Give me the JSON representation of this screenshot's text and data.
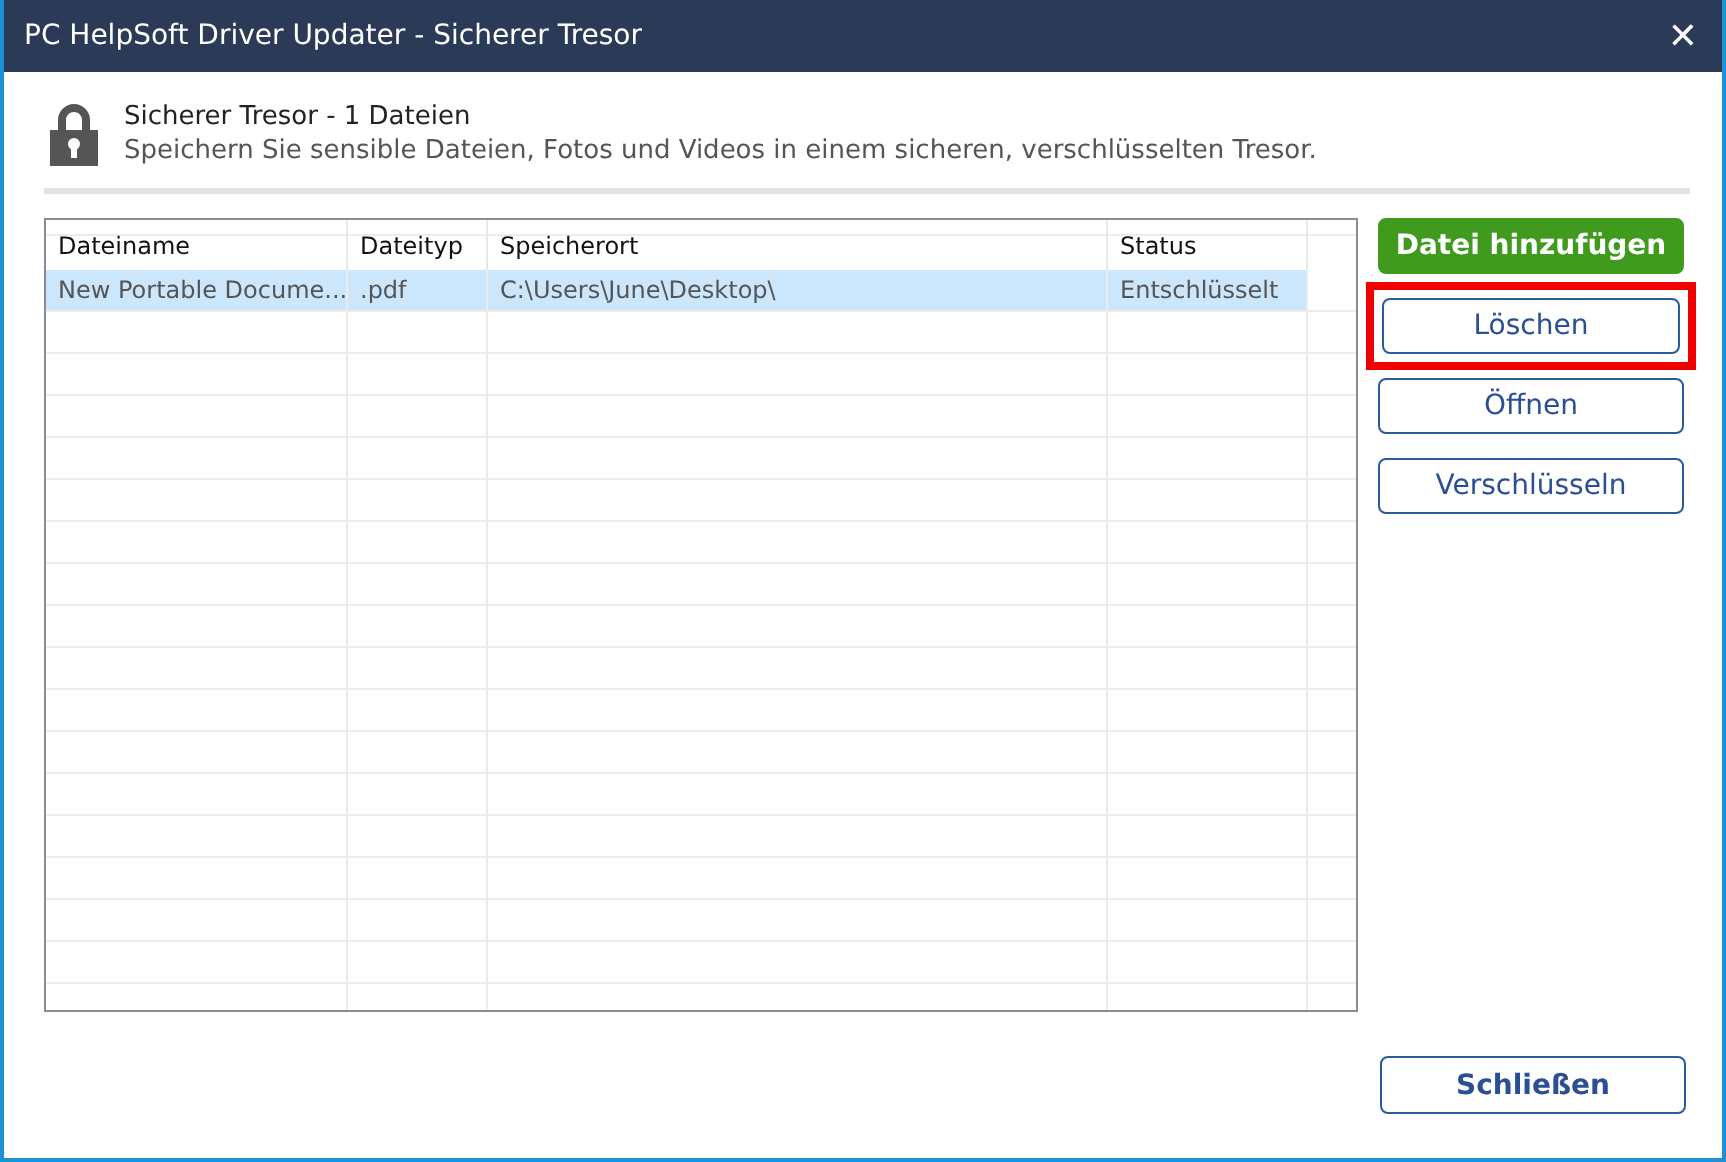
{
  "window": {
    "title": "PC HelpSoft Driver Updater - Sicherer Tresor",
    "close": "✕"
  },
  "header": {
    "title": "Sicherer Tresor - 1 Dateien",
    "subtitle": "Speichern Sie sensible Dateien, Fotos und Videos in einem sicheren, verschlüsselten Tresor."
  },
  "table": {
    "columns": [
      "Dateiname",
      "Dateityp",
      "Speicherort",
      "Status"
    ],
    "rows": [
      {
        "cells": [
          "New Portable Docume...",
          ".pdf",
          "C:\\Users\\June\\Desktop\\",
          "Entschlüsselt"
        ],
        "selected": true
      }
    ]
  },
  "actions": [
    {
      "label": "Datei hinzufügen",
      "kind": "primary",
      "highlighted": false
    },
    {
      "label": "Löschen",
      "kind": "outline",
      "highlighted": true
    },
    {
      "label": "Öffnen",
      "kind": "outline",
      "highlighted": false
    },
    {
      "label": "Verschlüsseln",
      "kind": "outline",
      "highlighted": false
    }
  ],
  "close_button": "Schließen"
}
